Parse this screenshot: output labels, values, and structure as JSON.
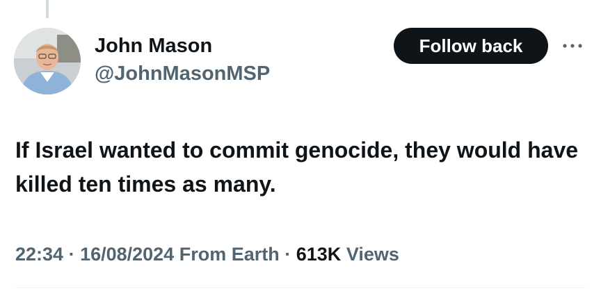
{
  "author": {
    "name": "John Mason",
    "handle": "@JohnMasonMSP"
  },
  "actions": {
    "follow_label": "Follow back",
    "more_icon": "more-horizontal-icon"
  },
  "tweet": {
    "text": "If Israel wanted to commit genocide, they would have killed ten times as many."
  },
  "meta": {
    "time": "22:34",
    "separator": " · ",
    "date": "16/08/2024",
    "source": "From Earth",
    "views_count": "613K",
    "views_label": "Views"
  },
  "colors": {
    "primary_text": "#0f1419",
    "secondary_text": "#536471",
    "button_bg": "#0f1419",
    "button_text": "#ffffff",
    "divider": "#eff3f4"
  }
}
